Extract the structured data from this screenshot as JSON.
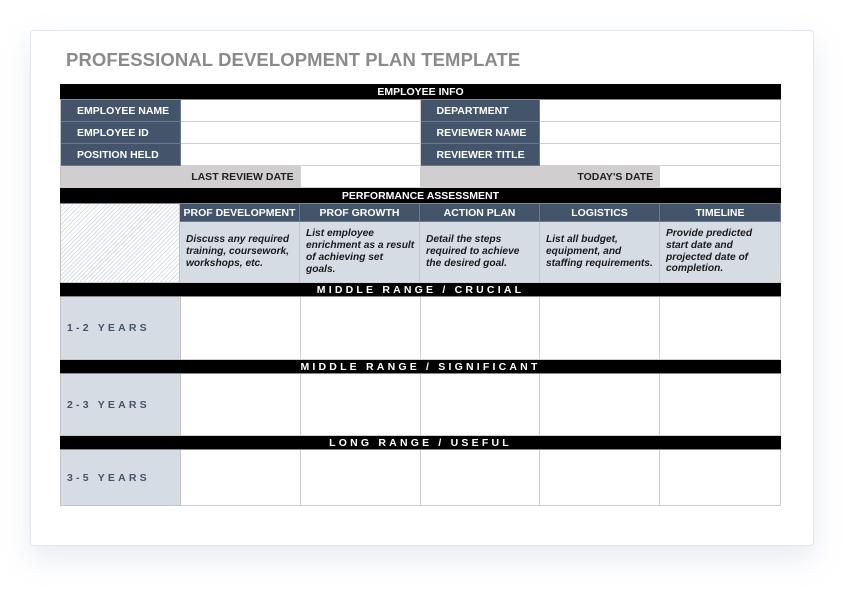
{
  "title": "PROFESSIONAL DEVELOPMENT PLAN TEMPLATE",
  "employee_info": {
    "header": "EMPLOYEE INFO",
    "left_fields": [
      {
        "label": "EMPLOYEE NAME",
        "value": ""
      },
      {
        "label": "EMPLOYEE ID",
        "value": ""
      },
      {
        "label": "POSITION HELD",
        "value": ""
      }
    ],
    "right_fields": [
      {
        "label": "DEPARTMENT",
        "value": ""
      },
      {
        "label": "REVIEWER NAME",
        "value": ""
      },
      {
        "label": "REVIEWER TITLE",
        "value": ""
      }
    ],
    "last_review_date": {
      "label": "LAST REVIEW DATE",
      "value": ""
    },
    "todays_date": {
      "label": "TODAY'S DATE",
      "value": ""
    }
  },
  "performance": {
    "header": "PERFORMANCE ASSESSMENT",
    "columns": [
      {
        "label": "PROF DEVELOPMENT",
        "description": "Discuss any required training, coursework, workshops, etc."
      },
      {
        "label": "PROF GROWTH",
        "description": "List employee enrichment as a result of achieving set goals."
      },
      {
        "label": "ACTION PLAN",
        "description": "Detail the steps required to achieve the desired goal."
      },
      {
        "label": "LOGISTICS",
        "description": "List all budget, equipment, and staffing requirements."
      },
      {
        "label": "TIMELINE",
        "description": "Provide predicted start date and projected date of completion."
      }
    ],
    "sections": [
      {
        "band": "MIDDLE RANGE / CRUCIAL",
        "row_label": "1-2 YEARS",
        "cells": [
          "",
          "",
          "",
          "",
          ""
        ]
      },
      {
        "band": "MIDDLE RANGE / SIGNIFICANT",
        "row_label": "2-3 YEARS",
        "cells": [
          "",
          "",
          "",
          "",
          ""
        ]
      },
      {
        "band": "LONG RANGE / USEFUL",
        "row_label": "3-5 YEARS",
        "cells": [
          "",
          "",
          "",
          "",
          ""
        ]
      }
    ]
  }
}
